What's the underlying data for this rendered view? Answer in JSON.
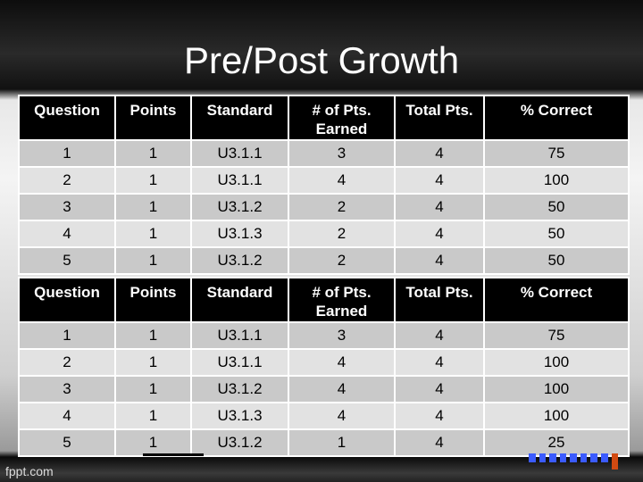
{
  "title": "Pre/Post Growth",
  "headers": [
    "Question",
    "Points",
    "Standard",
    "# of Pts. Earned",
    "Total Pts.",
    "% Correct"
  ],
  "pre": [
    [
      "1",
      "1",
      "U3.1.1",
      "3",
      "4",
      "75"
    ],
    [
      "2",
      "1",
      "U3.1.1",
      "4",
      "4",
      "100"
    ],
    [
      "3",
      "1",
      "U3.1.2",
      "2",
      "4",
      "50"
    ],
    [
      "4",
      "1",
      "U3.1.3",
      "2",
      "4",
      "50"
    ],
    [
      "5",
      "1",
      "U3.1.2",
      "2",
      "4",
      "50"
    ]
  ],
  "post": [
    [
      "1",
      "1",
      "U3.1.1",
      "3",
      "4",
      "75"
    ],
    [
      "2",
      "1",
      "U3.1.1",
      "4",
      "4",
      "100"
    ],
    [
      "3",
      "1",
      "U3.1.2",
      "4",
      "4",
      "100"
    ],
    [
      "4",
      "1",
      "U3.1.3",
      "4",
      "4",
      "100"
    ],
    [
      "5",
      "1",
      "U3.1.2",
      "1",
      "4",
      "25"
    ]
  ],
  "brand": "fppt.com"
}
